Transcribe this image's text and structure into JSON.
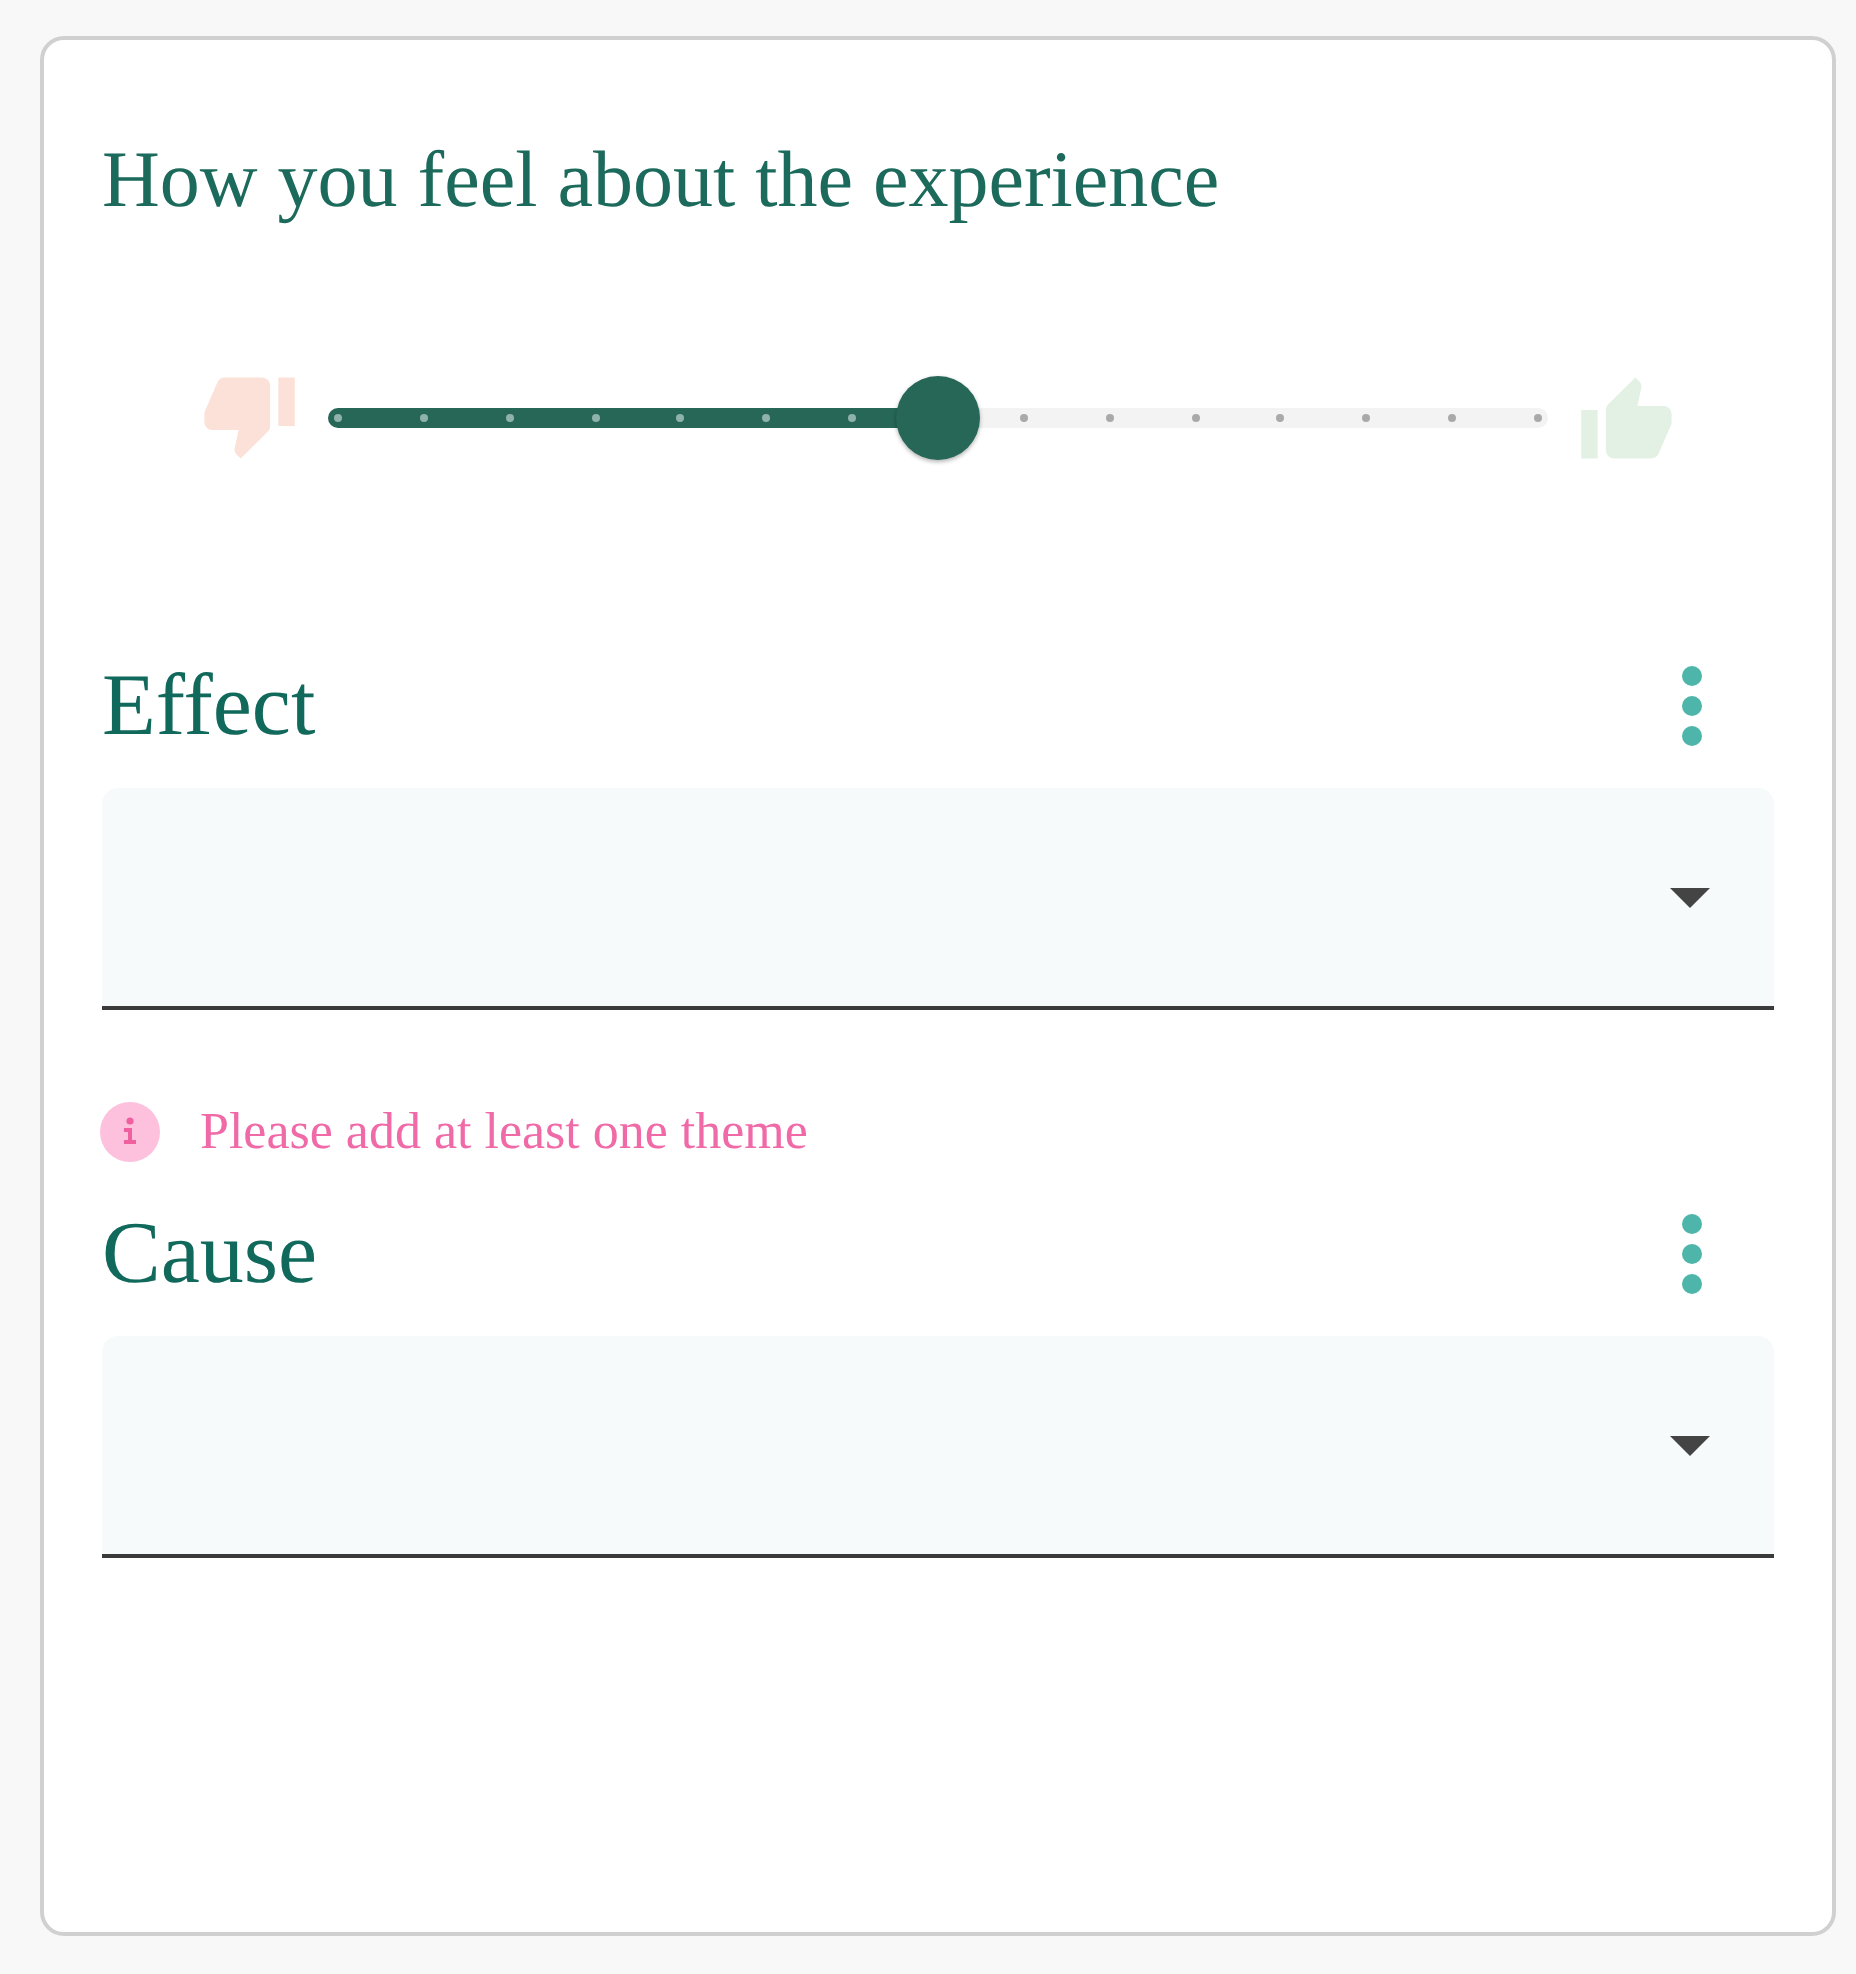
{
  "card": {
    "title": "How you feel about the experience"
  },
  "sentiment_slider": {
    "level": 0.5
  },
  "sections": [
    {
      "title": "Effect",
      "warning": "Please add at least one theme"
    },
    {
      "title": "Cause"
    }
  ]
}
